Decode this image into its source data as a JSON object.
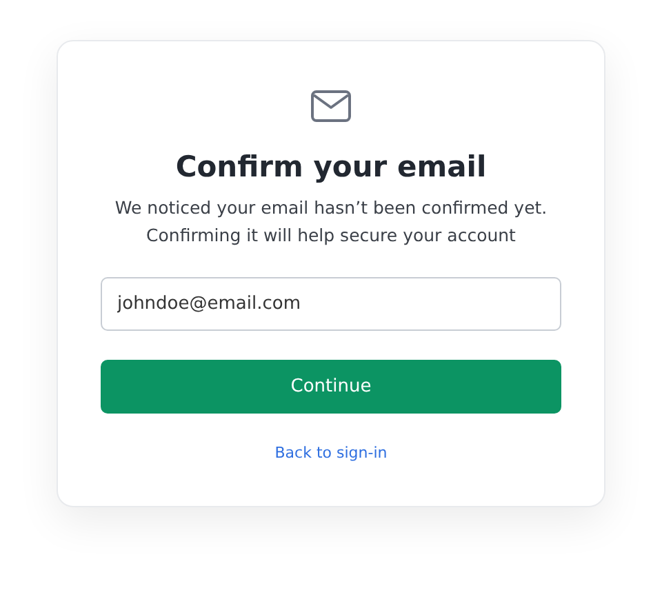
{
  "title": "Confirm your email",
  "message": "We noticed your email hasn’t been confirmed yet. Confirming it will help secure your account",
  "email_field": {
    "value": "johndoe@email.com"
  },
  "continue_button": "Continue",
  "back_link": "Back to sign-in"
}
